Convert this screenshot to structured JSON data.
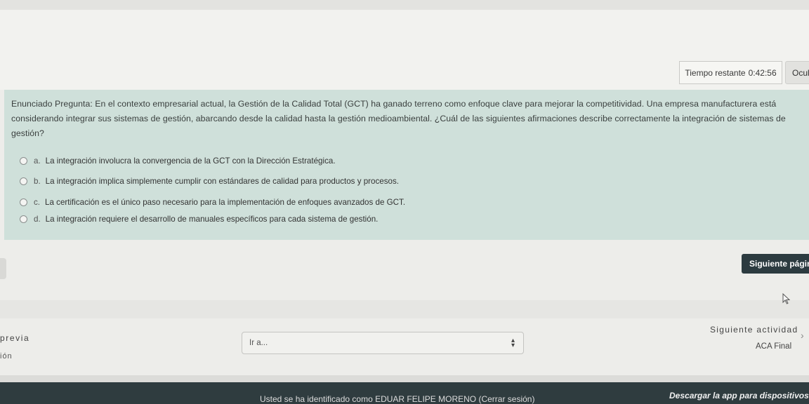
{
  "timer": {
    "label": "Tiempo restante",
    "value": "0:42:56",
    "hide_label": "Ocul"
  },
  "question": {
    "text": "Enunciado Pregunta: En el contexto empresarial actual, la Gestión de la Calidad Total (GCT) ha ganado terreno como enfoque clave para mejorar la competitividad. Una empresa manufacturera está considerando integrar sus sistemas de gestión, abarcando desde la calidad hasta la gestión medioambiental. ¿Cuál de las siguientes afirmaciones describe correctamente la integración de sistemas de gestión?",
    "options": [
      {
        "letter": "a.",
        "text": "La integración involucra la convergencia de la GCT con la Dirección Estratégica."
      },
      {
        "letter": "b.",
        "text": "La integración implica simplemente cumplir con estándares de calidad para productos y procesos."
      },
      {
        "letter": "c.",
        "text": "La certificación es el único paso necesario para la implementación de enfoques avanzados de GCT."
      },
      {
        "letter": "d.",
        "text": "La integración requiere el desarrollo de manuales específicos para cada sistema de gestión."
      }
    ]
  },
  "navigation": {
    "next_page_label": "Siguiente página",
    "prev_label": "previa",
    "prev_sub": "ión",
    "goto_placeholder": "Ir a...",
    "next_activity_label": "Siguiente actividad",
    "next_activity_name": "ACA Final"
  },
  "footer": {
    "user_text": "Usted se ha identificado como EDUAR FELIPE MORENO (Cerrar sesión)",
    "app_text": "Descargar la app para dispositivos mó"
  }
}
